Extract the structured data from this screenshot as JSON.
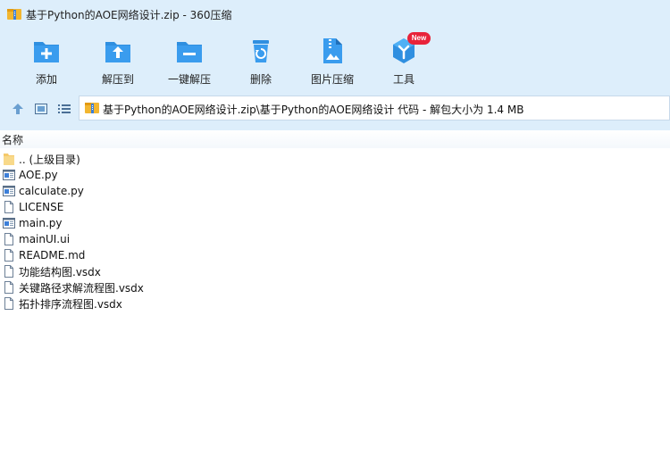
{
  "window": {
    "title": "基于Python的AOE网络设计.zip - 360压缩"
  },
  "toolbar": {
    "items": [
      {
        "label": "添加",
        "icon": "add-folder-icon"
      },
      {
        "label": "解压到",
        "icon": "extract-to-icon"
      },
      {
        "label": "一键解压",
        "icon": "one-click-extract-icon"
      },
      {
        "label": "删除",
        "icon": "recycle-bin-icon"
      },
      {
        "label": "图片压缩",
        "icon": "image-compress-icon"
      },
      {
        "label": "工具",
        "icon": "tools-icon",
        "badge": "New"
      }
    ],
    "accent": "#2f8fe0"
  },
  "addressbar": {
    "path": "基于Python的AOE网络设计.zip\\基于Python的AOE网络设计 代码 - 解包大小为 1.4 MB"
  },
  "filelist": {
    "column_name": "名称",
    "rows": [
      {
        "name": ".. (上级目录)",
        "type": "parent-folder"
      },
      {
        "name": "AOE.py",
        "type": "python"
      },
      {
        "name": "calculate.py",
        "type": "python"
      },
      {
        "name": "LICENSE",
        "type": "file"
      },
      {
        "name": "main.py",
        "type": "python"
      },
      {
        "name": "mainUI.ui",
        "type": "file"
      },
      {
        "name": "README.md",
        "type": "file"
      },
      {
        "name": "功能结构图.vsdx",
        "type": "file"
      },
      {
        "name": "关键路径求解流程图.vsdx",
        "type": "file"
      },
      {
        "name": "拓扑排序流程图.vsdx",
        "type": "file"
      }
    ]
  }
}
